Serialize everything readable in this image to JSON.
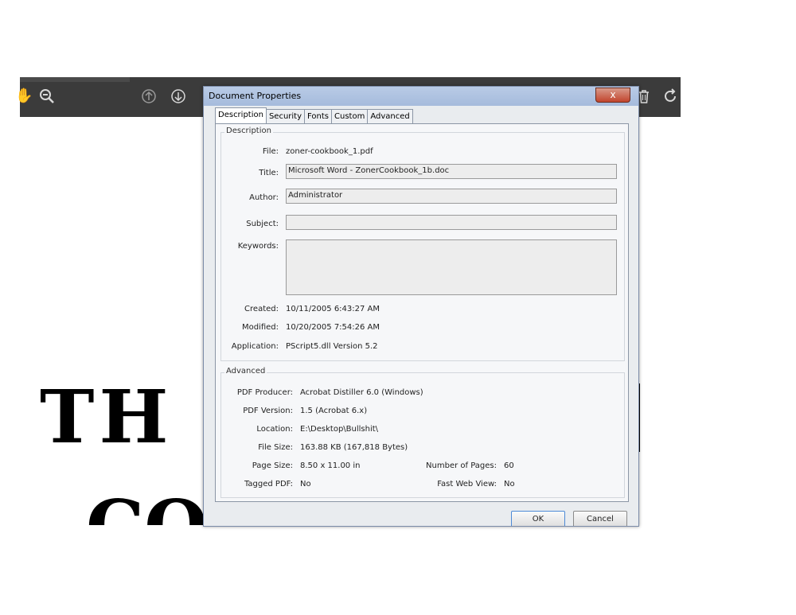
{
  "toolbar": {
    "icons": [
      "hand-icon",
      "zoom-out-icon",
      "page-up-icon",
      "page-down-icon",
      "delete-icon",
      "rotate-icon"
    ]
  },
  "background": {
    "text_line1": "TH",
    "text_line2": "CO"
  },
  "dialog": {
    "title": "Document Properties",
    "close_label": "x",
    "tabs": [
      "Description",
      "Security",
      "Fonts",
      "Custom",
      "Advanced"
    ],
    "description": {
      "group_label": "Description",
      "file_label": "File:",
      "file_value": "zoner-cookbook_1.pdf",
      "title_label": "Title:",
      "title_value": "Microsoft Word - ZonerCookbook_1b.doc",
      "author_label": "Author:",
      "author_value": "Administrator",
      "subject_label": "Subject:",
      "subject_value": "",
      "keywords_label": "Keywords:",
      "keywords_value": "",
      "created_label": "Created:",
      "created_value": "10/11/2005 6:43:27 AM",
      "modified_label": "Modified:",
      "modified_value": "10/20/2005 7:54:26 AM",
      "application_label": "Application:",
      "application_value": "PScript5.dll Version 5.2"
    },
    "advanced": {
      "group_label": "Advanced",
      "producer_label": "PDF Producer:",
      "producer_value": "Acrobat Distiller 6.0 (Windows)",
      "version_label": "PDF Version:",
      "version_value": "1.5 (Acrobat 6.x)",
      "location_label": "Location:",
      "location_value": "E:\\Desktop\\Bullshit\\",
      "filesize_label": "File Size:",
      "filesize_value": "163.88 KB (167,818 Bytes)",
      "pagesize_label": "Page Size:",
      "pagesize_value": "8.50 x 11.00 in",
      "pages_label": "Number of Pages:",
      "pages_value": "60",
      "tagged_label": "Tagged PDF:",
      "tagged_value": "No",
      "fastweb_label": "Fast Web View:",
      "fastweb_value": "No"
    },
    "ok_label": "OK",
    "cancel_label": "Cancel"
  }
}
